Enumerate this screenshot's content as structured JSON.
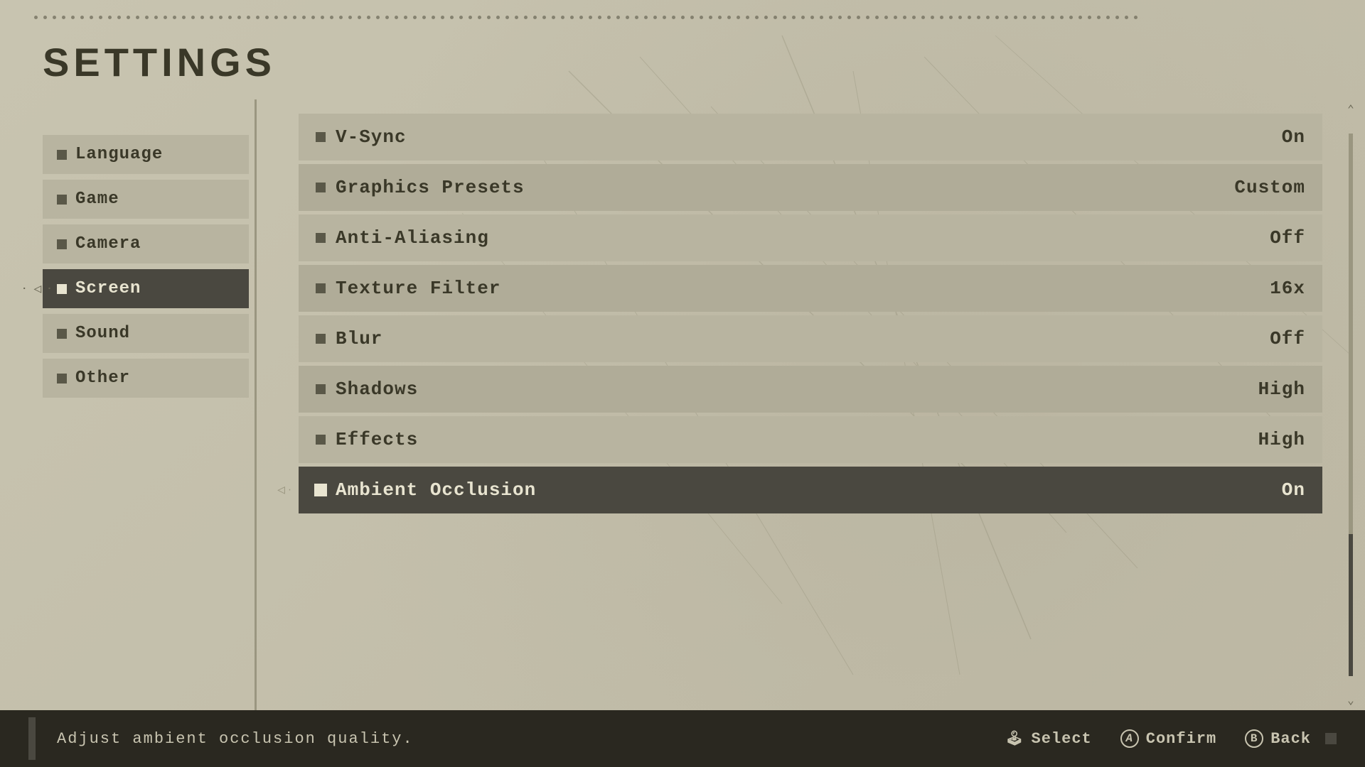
{
  "page": {
    "title": "SETTINGS",
    "bg_color": "#c8c4b0"
  },
  "sidebar": {
    "items": [
      {
        "id": "language",
        "label": "Language",
        "active": false
      },
      {
        "id": "game",
        "label": "Game",
        "active": false
      },
      {
        "id": "camera",
        "label": "Camera",
        "active": false
      },
      {
        "id": "screen",
        "label": "Screen",
        "active": true
      },
      {
        "id": "sound",
        "label": "Sound",
        "active": false
      },
      {
        "id": "other",
        "label": "Other",
        "active": false
      }
    ]
  },
  "settings": {
    "items": [
      {
        "id": "vsync",
        "label": "V-Sync",
        "value": "On",
        "active": false
      },
      {
        "id": "graphics-presets",
        "label": "Graphics Presets",
        "value": "Custom",
        "active": false
      },
      {
        "id": "anti-aliasing",
        "label": "Anti-Aliasing",
        "value": "Off",
        "active": false
      },
      {
        "id": "texture-filter",
        "label": "Texture Filter",
        "value": "16x",
        "active": false
      },
      {
        "id": "blur",
        "label": "Blur",
        "value": "Off",
        "active": false
      },
      {
        "id": "shadows",
        "label": "Shadows",
        "value": "High",
        "active": false
      },
      {
        "id": "effects",
        "label": "Effects",
        "value": "High",
        "active": false
      },
      {
        "id": "ambient-occlusion",
        "label": "Ambient Occlusion",
        "value": "On",
        "active": true
      }
    ]
  },
  "bottom_bar": {
    "hint": "Adjust ambient occlusion quality.",
    "controls": [
      {
        "id": "select",
        "icon": "🕹",
        "label": "Select"
      },
      {
        "id": "confirm",
        "icon": "Ⓐ",
        "label": "Confirm"
      },
      {
        "id": "back",
        "icon": "Ⓑ",
        "label": "Back"
      }
    ]
  }
}
